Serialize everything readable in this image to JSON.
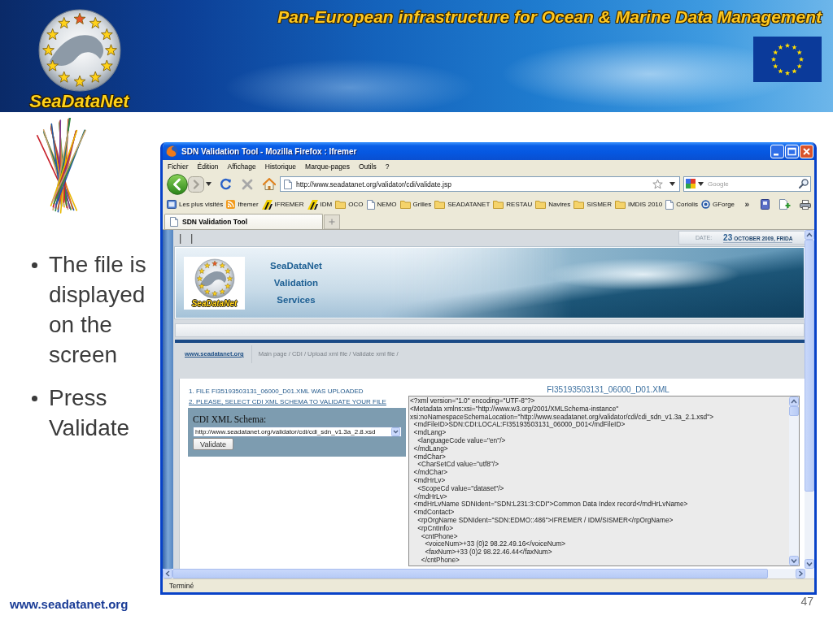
{
  "banner": {
    "logo_text": "SeaDataNet",
    "title": "Pan-European infrastructure for Ocean & Marine Data Management"
  },
  "bullets": [
    "The file is displayed on the screen",
    "Press Validate"
  ],
  "browser": {
    "window": {
      "title": "SDN Validation Tool - Mozilla Firefox : Ifremer"
    },
    "menu": [
      "Fichier",
      "Édition",
      "Affichage",
      "Historique",
      "Marque-pages",
      "Outils",
      "?"
    ],
    "address": {
      "value": "http://www.seadatanet.org/validator/cdi/validate.jsp"
    },
    "search": {
      "placeholder": "Google"
    },
    "bookmarks": [
      {
        "label": "Les plus visités",
        "kind": "smart"
      },
      {
        "label": "Ifremer",
        "kind": "feed"
      },
      {
        "label": "IFREMER",
        "kind": "logo"
      },
      {
        "label": "IDM",
        "kind": "logo"
      },
      {
        "label": "OCO",
        "kind": "folder"
      },
      {
        "label": "NEMO",
        "kind": "page"
      },
      {
        "label": "Grilles",
        "kind": "folder"
      },
      {
        "label": "SEADATANET",
        "kind": "folder"
      },
      {
        "label": "RESTAU",
        "kind": "folder"
      },
      {
        "label": "Navires",
        "kind": "folder"
      },
      {
        "label": "SISMER",
        "kind": "folder"
      },
      {
        "label": "IMDIS 2010",
        "kind": "folder"
      },
      {
        "label": "Coriolis",
        "kind": "page"
      },
      {
        "label": "GForge",
        "kind": "circle"
      }
    ],
    "overflow": "»",
    "tabs": [
      {
        "label": "SDN Validation Tool",
        "selected": true
      }
    ],
    "status_bar": "Terminé"
  },
  "page": {
    "marks": "| |",
    "date": {
      "label": "DATE:",
      "day": "23",
      "text": "OCTOBER 2009, FRIDA"
    },
    "logo_text": "SeaDataNet",
    "header_lines": [
      "SeaDataNet",
      "Validation",
      "Services"
    ],
    "breadcrumb": {
      "home": "www.seadatanet.org",
      "path": "Main page / CDI / Upload xml file / Validate xml file /"
    },
    "steps": [
      {
        "kind": "text",
        "text": "1. FILE FI35193503131_06000_D01.XML WAS UPLOADED"
      },
      {
        "kind": "link",
        "text": "2. PLEASE, SELECT CDI XML SCHEMA TO VALIDATE YOUR FILE"
      }
    ],
    "form": {
      "label": "CDI XML Schema:",
      "schema": "http://www.seadatanet.org/validator/cdi/cdi_sdn_v1.3a_2.8.xsd",
      "button": "Validate"
    },
    "file_title": "FI35193503131_06000_D01.XML",
    "xml_lines": [
      "<?xml version=\"1.0\" encoding=\"UTF-8\"?>",
      "<Metadata xmlns:xsi=\"http://www.w3.org/2001/XMLSchema-instance\"",
      "xsi:noNamespaceSchemaLocation=\"http://www.seadatanet.org/validator/cdi/cdi_sdn_v1.3a_2.1.xsd\">",
      "  <mdFileID>SDN:CDI:LOCAL:FI35193503131_06000_D01</mdFileID>",
      "  <mdLang>",
      "    <languageCode value=\"en\"/>",
      "  </mdLang>",
      "  <mdChar>",
      "    <CharSetCd value=\"utf8\"/>",
      "  </mdChar>",
      "  <mdHrLv>",
      "    <ScopeCd value=\"dataset\"/>",
      "  </mdHrLv>",
      "  <mdHrLvName SDNIdent=\"SDN:L231:3:CDI\">Common Data Index record</mdHrLvName>",
      "  <mdContact>",
      "    <rpOrgName SDNIdent=\"SDN:EDMO::486\">IFREMER / IDM/SISMER</rpOrgName>",
      "    <rpCntInfo>",
      "      <cntPhone>",
      "        <voiceNum>+33 (0)2 98.22.49.16</voiceNum>",
      "        <faxNum>+33 (0)2 98.22.46.44</faxNum>",
      "      </cntPhone>"
    ]
  },
  "slide": {
    "footer": "www.seadatanet.org",
    "page_number": "47"
  }
}
